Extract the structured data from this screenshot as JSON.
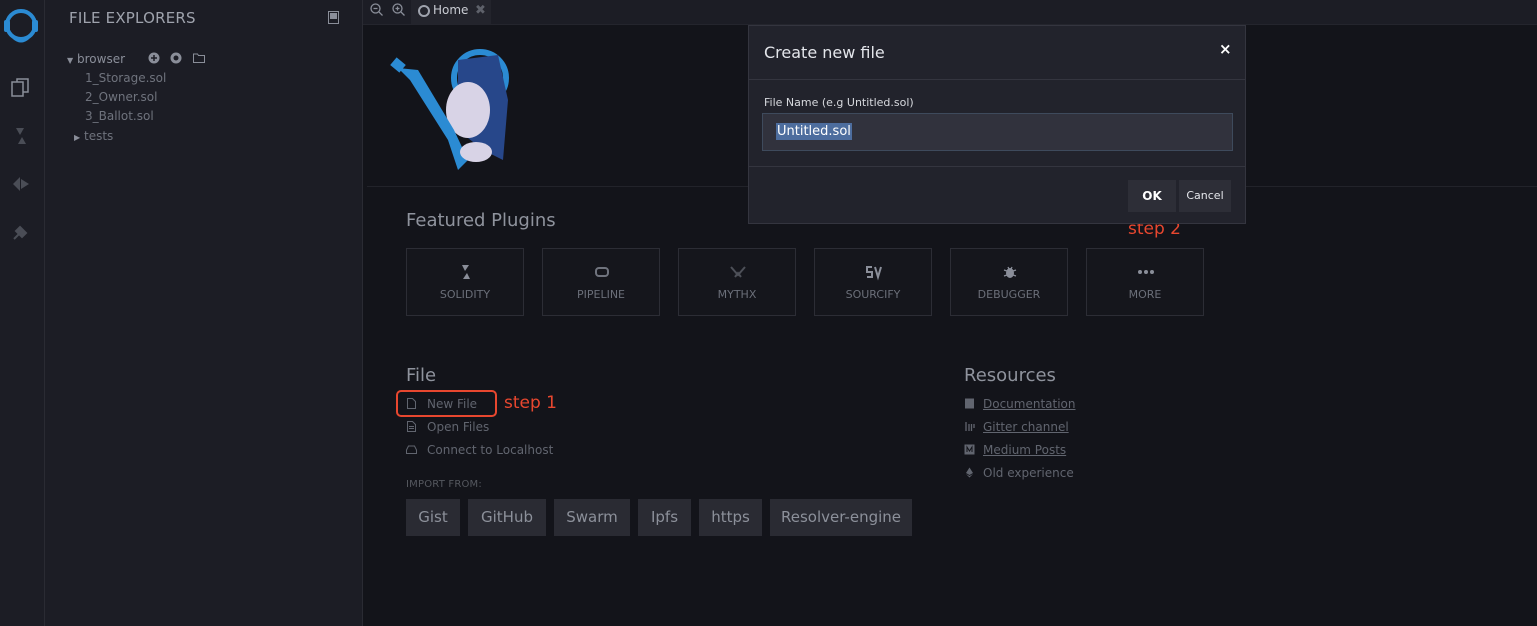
{
  "sidebar": {
    "title": "FILE EXPLORERS"
  },
  "tree": {
    "root": "browser",
    "files": [
      "1_Storage.sol",
      "2_Owner.sol",
      "3_Ballot.sol"
    ],
    "folder": "tests"
  },
  "tabs": [
    {
      "label": "Home"
    }
  ],
  "home": {
    "featured_title": "Featured Plugins",
    "plugins": [
      "SOLIDITY",
      "PIPELINE",
      "MYTHX",
      "SOURCIFY",
      "DEBUGGER",
      "MORE"
    ],
    "file_title": "File",
    "file_links": [
      "New File",
      "Open Files",
      "Connect to Localhost"
    ],
    "import_label": "IMPORT FROM:",
    "import_buttons": [
      "Gist",
      "GitHub",
      "Swarm",
      "Ipfs",
      "https",
      "Resolver-engine"
    ],
    "resources_title": "Resources",
    "resource_links": [
      "Documentation",
      "Gitter channel",
      "Medium Posts",
      "Old experience"
    ]
  },
  "annotations": {
    "step1": "step 1",
    "step2": "step 2"
  },
  "modal": {
    "title": "Create new file",
    "close": "×",
    "field_label": "File Name (e.g Untitled.sol)",
    "field_value": "Untitled.sol",
    "ok": "OK",
    "cancel": "Cancel"
  },
  "colors": {
    "accent": "#2b8bd3",
    "annotation": "#e8472f",
    "background": "#13141a",
    "panel": "#1c1d25"
  }
}
